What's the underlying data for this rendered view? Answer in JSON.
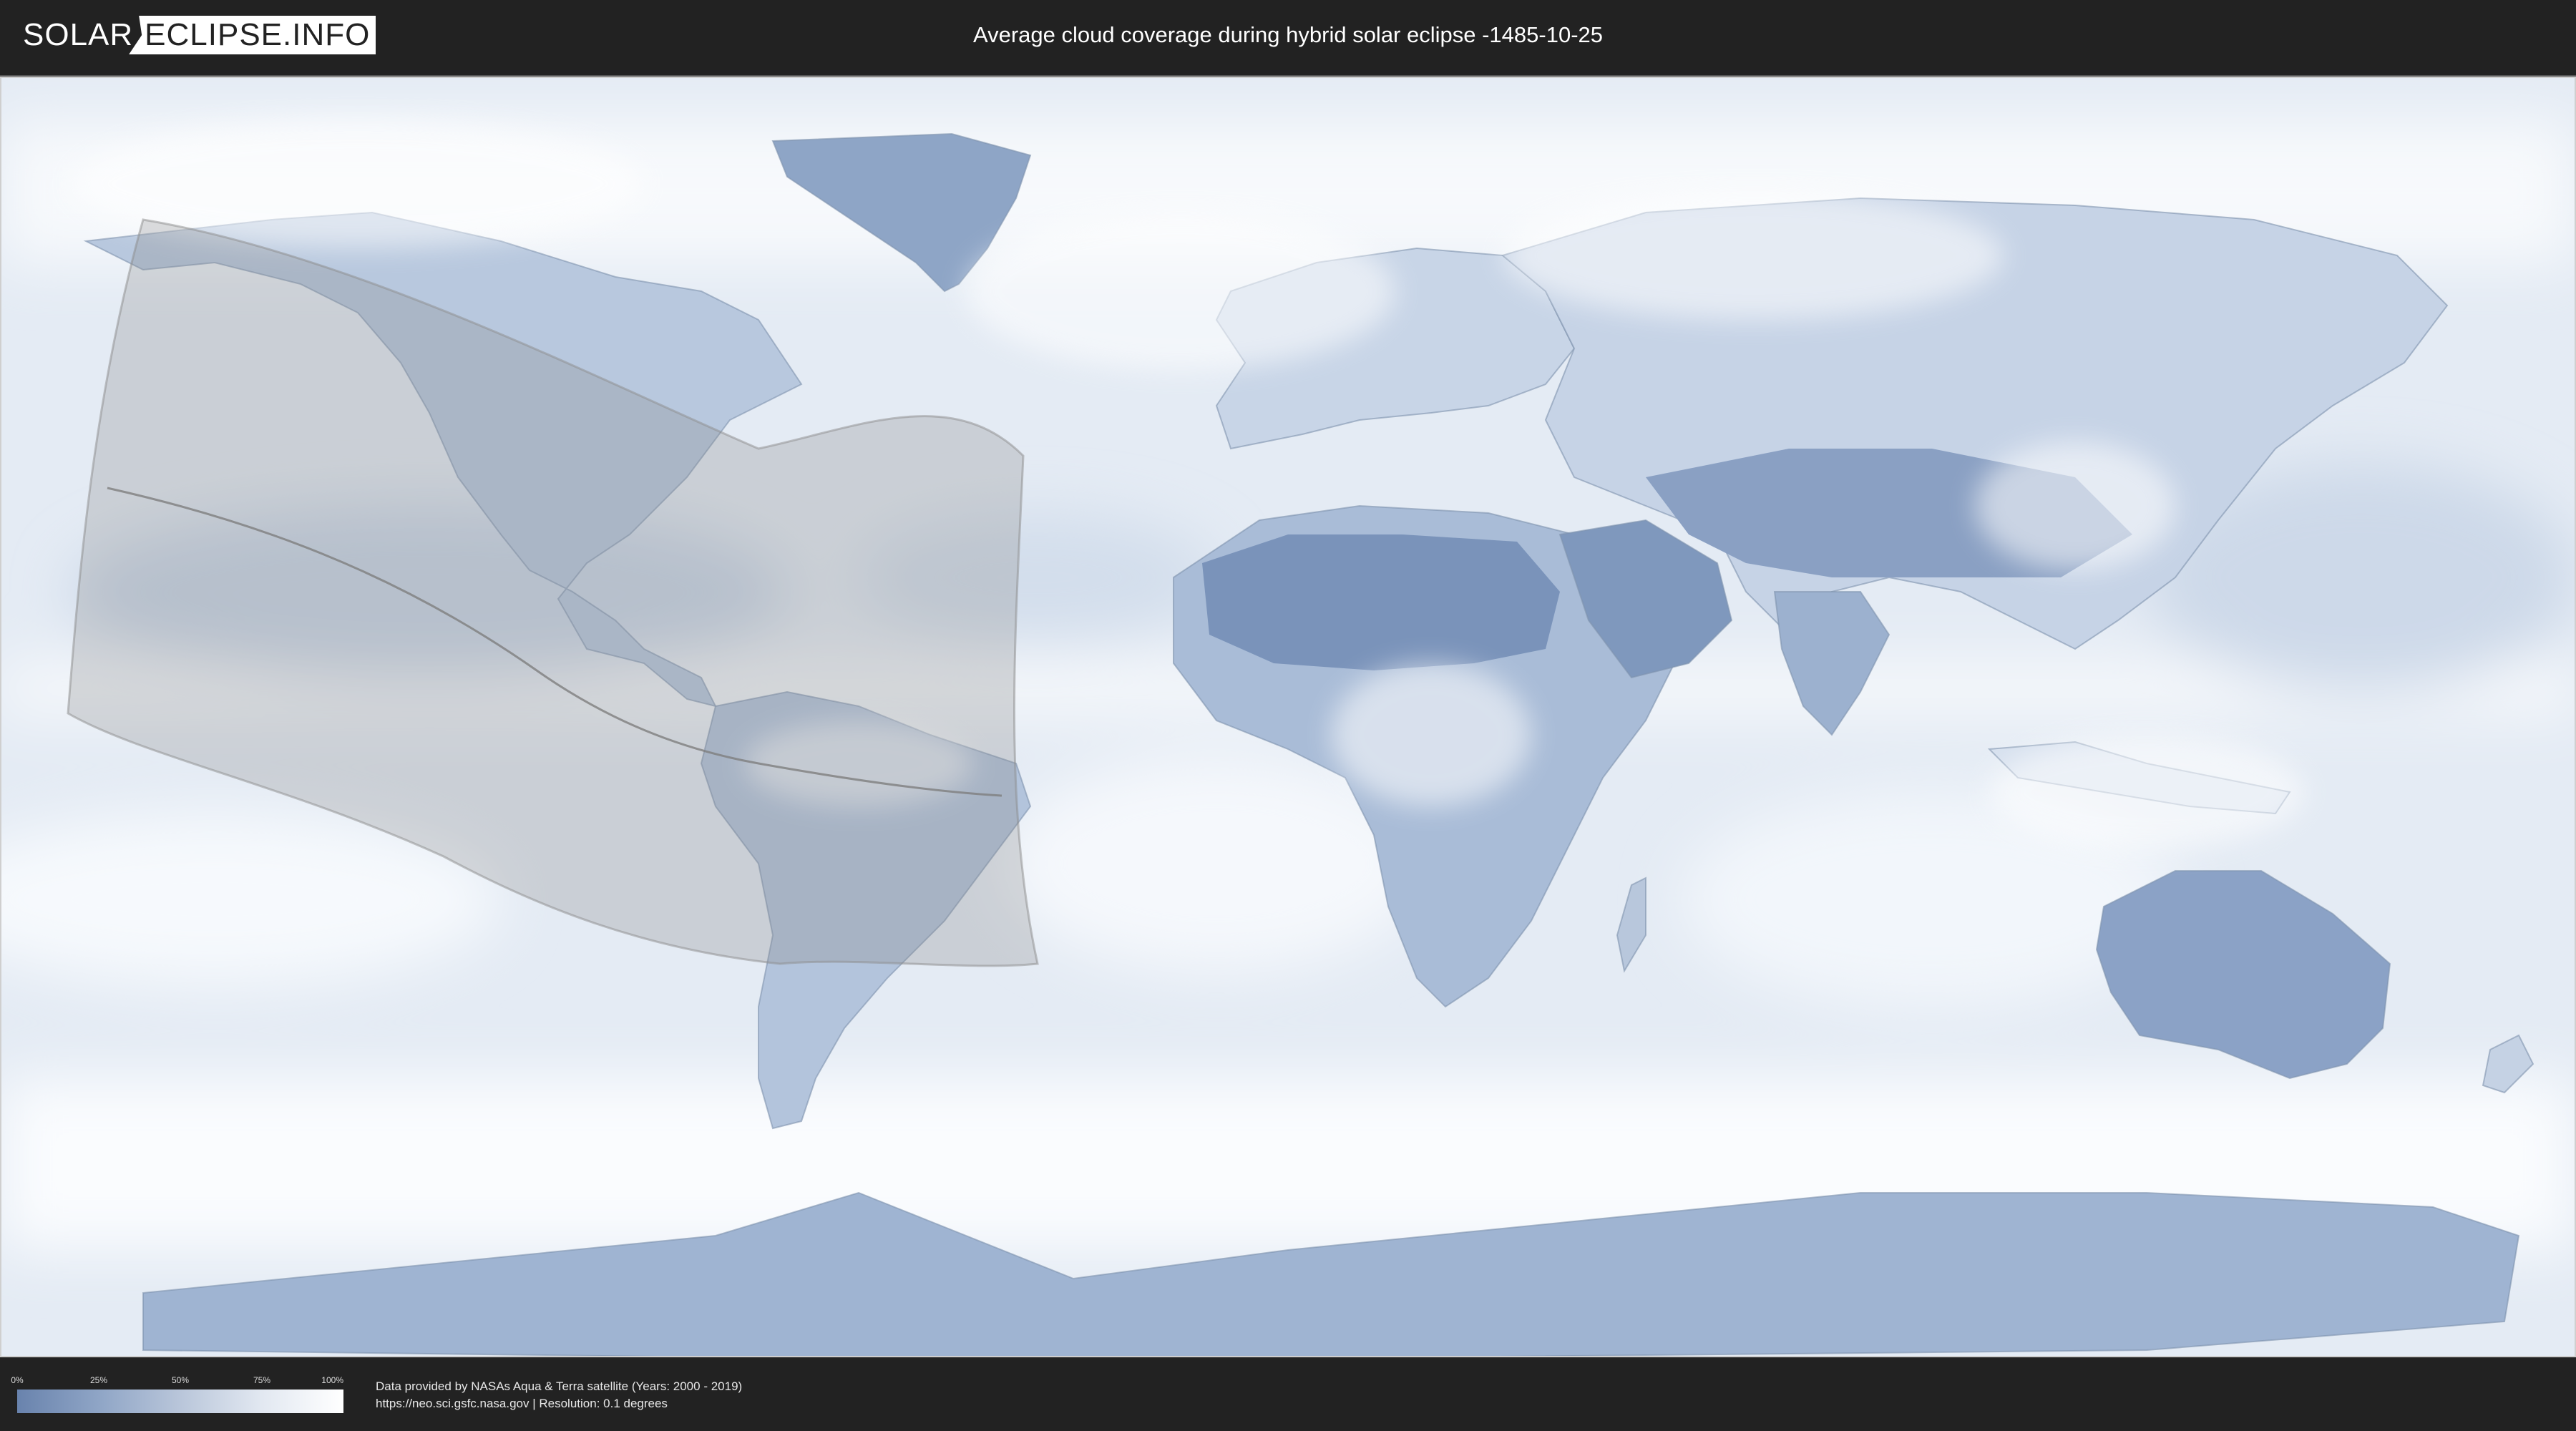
{
  "header": {
    "logo_left": "SOLAR",
    "logo_right": "ECLIPSE.INFO",
    "title": "Average cloud coverage during hybrid solar eclipse -1485-10-25"
  },
  "map": {
    "ocean_color": "#e7eef6",
    "land_clear_color": "#6f8bb5",
    "cloud_color": "#ffffff",
    "eclipse_zone_color": "#9a9a9a"
  },
  "legend": {
    "ticks": [
      "0%",
      "25%",
      "50%",
      "75%",
      "100%"
    ],
    "tick_values": [
      0,
      25,
      50,
      75,
      100
    ],
    "gradient_start": "#6983ad",
    "gradient_end": "#ffffff"
  },
  "footer": {
    "credit_line1": "Data provided by NASAs Aqua & Terra satellite (Years: 2000 - 2019)",
    "credit_line2": "https://neo.sci.gsfc.nasa.gov | Resolution: 0.1 degrees"
  }
}
